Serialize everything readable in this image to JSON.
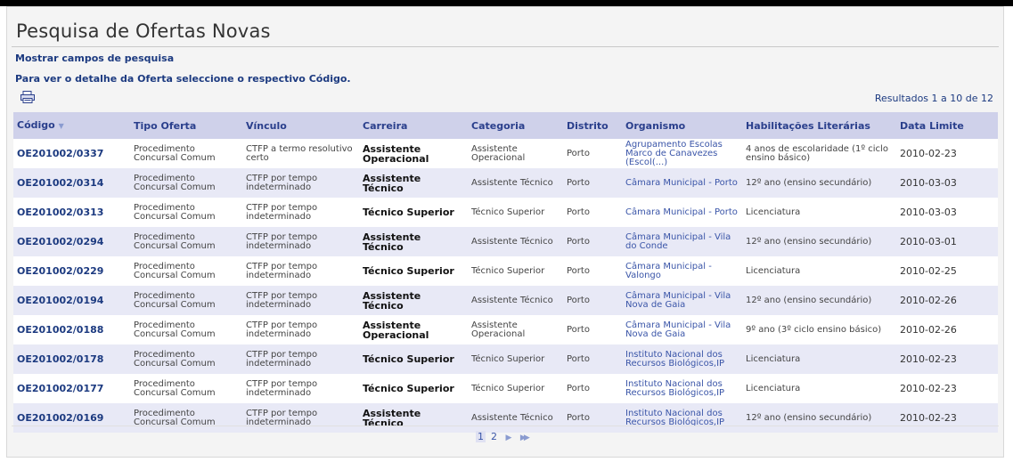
{
  "title": "Pesquisa de Ofertas Novas",
  "show_search_fields": "Mostrar campos de pesquisa",
  "instruction": "Para ver o detalhe da Oferta seleccione o respectivo Código.",
  "results_text": "Resultados 1 a 10 de 12",
  "columns": [
    "Código",
    "Tipo Oferta",
    "Vínculo",
    "Carreira",
    "Categoria",
    "Distrito",
    "Organismo",
    "Habilitações Literárias",
    "Data Limite"
  ],
  "sort_indicator": "▼",
  "rows": [
    {
      "codigo": "OE201002/0337",
      "tipo": "Procedimento Concursal Comum",
      "vinculo": "CTFP a termo resolutivo certo",
      "carreira": "Assistente Operacional",
      "categoria": "Assistente Operacional",
      "distrito": "Porto",
      "organismo": "Agrupamento Escolas Marco de Canavezes (Escol(...)",
      "habilitacoes": "4 anos de escolaridade (1º ciclo ensino básico)",
      "data": "2010-02-23"
    },
    {
      "codigo": "OE201002/0314",
      "tipo": "Procedimento Concursal Comum",
      "vinculo": "CTFP por tempo indeterminado",
      "carreira": "Assistente Técnico",
      "categoria": "Assistente Técnico",
      "distrito": "Porto",
      "organismo": "Câmara Municipal - Porto",
      "habilitacoes": "12º ano (ensino secundário)",
      "data": "2010-03-03"
    },
    {
      "codigo": "OE201002/0313",
      "tipo": "Procedimento Concursal Comum",
      "vinculo": "CTFP por tempo indeterminado",
      "carreira": "Técnico Superior",
      "categoria": "Técnico Superior",
      "distrito": "Porto",
      "organismo": "Câmara Municipal - Porto",
      "habilitacoes": "Licenciatura",
      "data": "2010-03-03"
    },
    {
      "codigo": "OE201002/0294",
      "tipo": "Procedimento Concursal Comum",
      "vinculo": "CTFP por tempo indeterminado",
      "carreira": "Assistente Técnico",
      "categoria": "Assistente Técnico",
      "distrito": "Porto",
      "organismo": "Câmara Municipal - Vila do Conde",
      "habilitacoes": "12º ano (ensino secundário)",
      "data": "2010-03-01"
    },
    {
      "codigo": "OE201002/0229",
      "tipo": "Procedimento Concursal Comum",
      "vinculo": "CTFP por tempo indeterminado",
      "carreira": "Técnico Superior",
      "categoria": "Técnico Superior",
      "distrito": "Porto",
      "organismo": "Câmara Municipal - Valongo",
      "habilitacoes": "Licenciatura",
      "data": "2010-02-25"
    },
    {
      "codigo": "OE201002/0194",
      "tipo": "Procedimento Concursal Comum",
      "vinculo": "CTFP por tempo indeterminado",
      "carreira": "Assistente Técnico",
      "categoria": "Assistente Técnico",
      "distrito": "Porto",
      "organismo": "Câmara Municipal - Vila Nova de Gaia",
      "habilitacoes": "12º ano (ensino secundário)",
      "data": "2010-02-26"
    },
    {
      "codigo": "OE201002/0188",
      "tipo": "Procedimento Concursal Comum",
      "vinculo": "CTFP por tempo indeterminado",
      "carreira": "Assistente Operacional",
      "categoria": "Assistente Operacional",
      "distrito": "Porto",
      "organismo": "Câmara Municipal - Vila Nova de Gaia",
      "habilitacoes": "9º ano (3º ciclo ensino básico)",
      "data": "2010-02-26"
    },
    {
      "codigo": "OE201002/0178",
      "tipo": "Procedimento Concursal Comum",
      "vinculo": "CTFP por tempo indeterminado",
      "carreira": "Técnico Superior",
      "categoria": "Técnico Superior",
      "distrito": "Porto",
      "organismo": "Instituto Nacional dos Recursos Biológicos,IP",
      "habilitacoes": "Licenciatura",
      "data": "2010-02-23"
    },
    {
      "codigo": "OE201002/0177",
      "tipo": "Procedimento Concursal Comum",
      "vinculo": "CTFP por tempo indeterminado",
      "carreira": "Técnico Superior",
      "categoria": "Técnico Superior",
      "distrito": "Porto",
      "organismo": "Instituto Nacional dos Recursos Biológicos,IP",
      "habilitacoes": "Licenciatura",
      "data": "2010-02-23"
    },
    {
      "codigo": "OE201002/0169",
      "tipo": "Procedimento Concursal Comum",
      "vinculo": "CTFP por tempo indeterminado",
      "carreira": "Assistente Técnico",
      "categoria": "Assistente Técnico",
      "distrito": "Porto",
      "organismo": "Instituto Nacional dos Recursos Biológicos,IP",
      "habilitacoes": "12º ano (ensino secundário)",
      "data": "2010-02-23"
    }
  ],
  "pagination": {
    "pages": [
      "1",
      "2"
    ],
    "current": "1",
    "next": "▶",
    "last": "▶▶"
  },
  "colors": {
    "header_bg": "#cfd1ea",
    "link": "#1c3a80",
    "row_alt": "#e8e9f6"
  }
}
